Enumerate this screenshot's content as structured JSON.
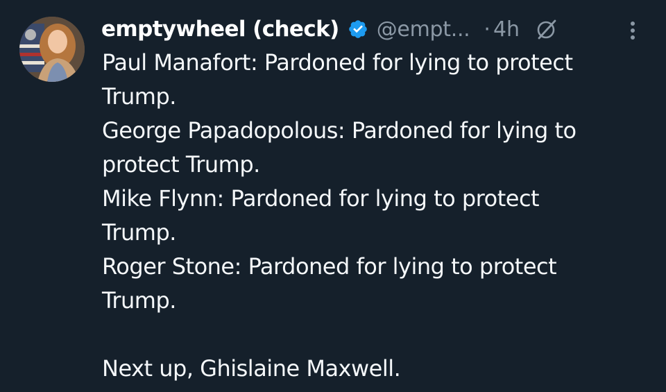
{
  "tweet": {
    "display_name": "emptywheel (check)",
    "handle": "@empt...",
    "separator": "·",
    "time": "4h",
    "icons": {
      "verified": "verified-badge-icon",
      "grok": "grok-icon",
      "more": "more-options-icon",
      "avatar": "profile-avatar"
    },
    "verified_color": "#1d9bf0",
    "text_lines": [
      "Paul Manafort: Pardoned for lying to protect",
      "Trump.",
      "George Papadopolous: Pardoned for lying to",
      "protect Trump.",
      "Mike Flynn: Pardoned for lying to protect",
      "Trump.",
      "Roger Stone: Pardoned for lying to protect",
      "Trump.",
      "",
      "Next up, Ghislaine Maxwell."
    ]
  },
  "colors": {
    "background": "#15202b",
    "text": "#f5f8fa",
    "secondary_text": "#8b98a5"
  }
}
